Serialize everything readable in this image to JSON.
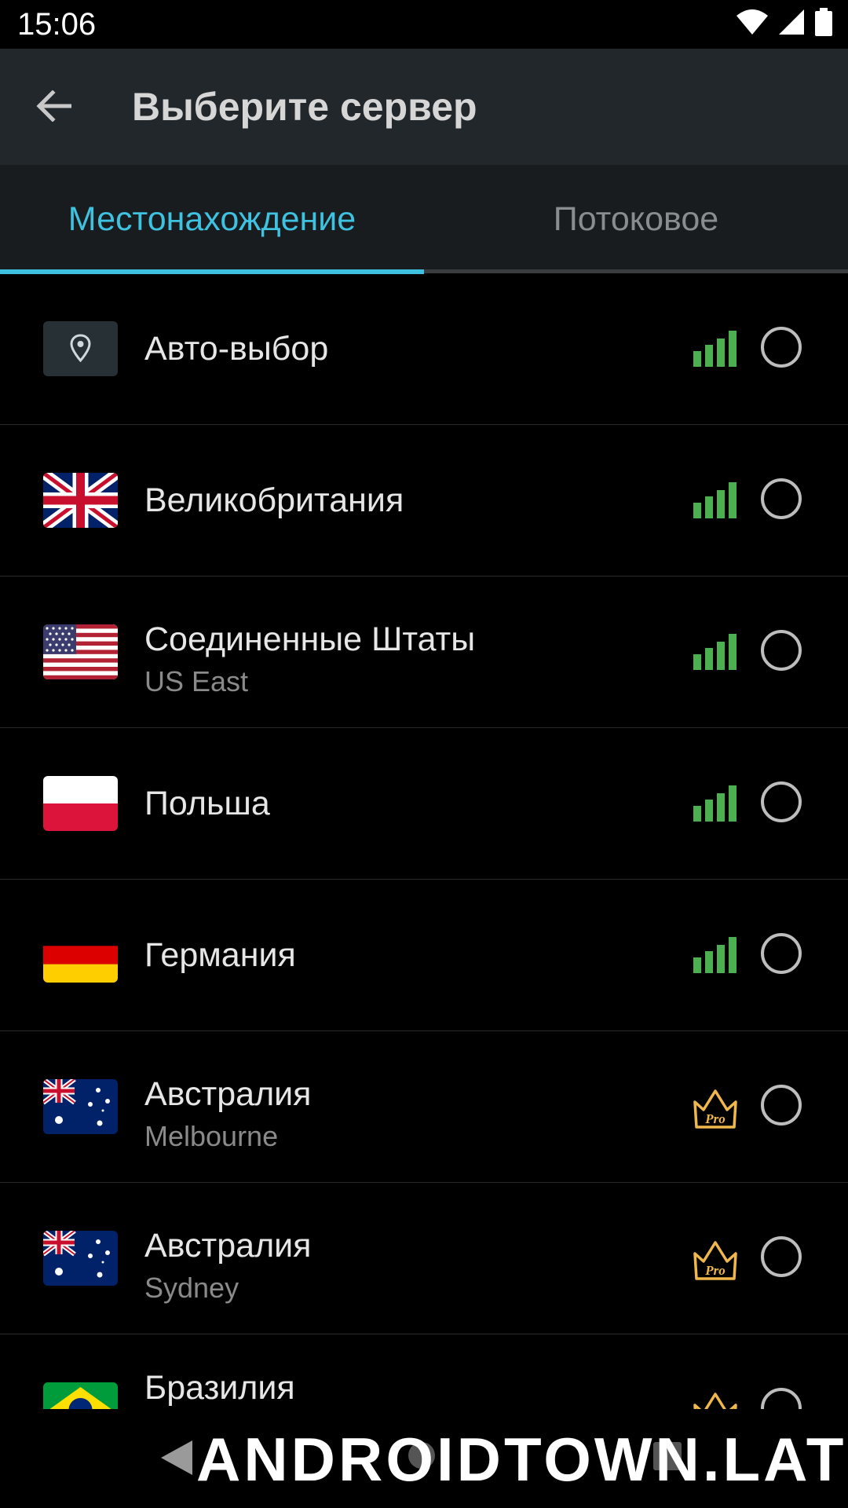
{
  "status_bar": {
    "time": "15:06",
    "icons": [
      "wifi-icon",
      "cell-signal-icon",
      "battery-icon"
    ]
  },
  "app_bar": {
    "title": "Выберите сервер",
    "back_icon": "arrow-left-icon"
  },
  "tabs": [
    {
      "label": "Местонахождение",
      "selected": true
    },
    {
      "label": "Потоковое",
      "selected": false
    }
  ],
  "colors": {
    "accent": "#3fc1e0",
    "signal": "#4caf50",
    "pro": "#f0b74c",
    "appbar": "#22272b"
  },
  "servers": [
    {
      "name": "Авто-выбор",
      "sub": "",
      "flag": "location-pin-icon",
      "status": "signal-strength-icon",
      "selected": false
    },
    {
      "name": "Великобритания",
      "sub": "",
      "flag": "uk-flag-icon",
      "status": "signal-strength-icon",
      "selected": false
    },
    {
      "name": "Соединенные Штаты",
      "sub": "US East",
      "flag": "us-flag-icon",
      "status": "signal-strength-icon",
      "selected": false
    },
    {
      "name": "Польша",
      "sub": "",
      "flag": "poland-flag-icon",
      "status": "signal-strength-icon",
      "selected": false
    },
    {
      "name": "Германия",
      "sub": "",
      "flag": "germany-flag-icon",
      "status": "signal-strength-icon",
      "selected": false
    },
    {
      "name": "Австралия",
      "sub": "Melbourne",
      "flag": "australia-flag-icon",
      "status": "pro-crown-icon",
      "selected": false
    },
    {
      "name": "Австралия",
      "sub": "Sydney",
      "flag": "australia-flag-icon",
      "status": "pro-crown-icon",
      "selected": false
    },
    {
      "name": "Бразилия",
      "sub": "",
      "flag": "brazil-flag-icon",
      "status": "pro-crown-icon",
      "selected": false
    }
  ],
  "pro_badge": "Pro",
  "nav_bar": {
    "icons": [
      "nav-back-icon",
      "nav-home-icon",
      "nav-recents-icon"
    ]
  },
  "watermark": "ANDROIDTOWN.LAT"
}
